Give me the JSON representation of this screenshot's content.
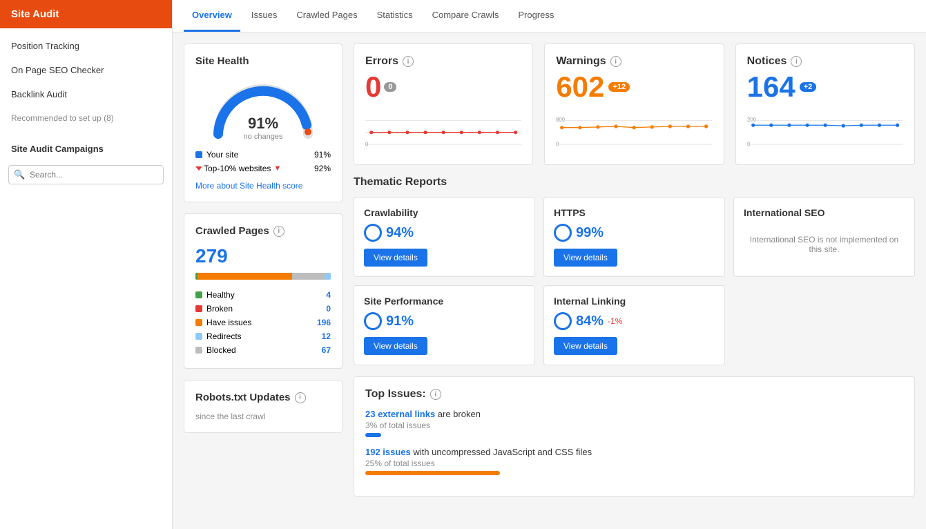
{
  "sidebar": {
    "header": "Site Audit",
    "nav": [
      {
        "label": "Position Tracking",
        "id": "position-tracking"
      },
      {
        "label": "On Page SEO Checker",
        "id": "on-page-seo"
      },
      {
        "label": "Backlink Audit",
        "id": "backlink-audit"
      },
      {
        "label": "Recommended to set up (8)",
        "id": "recommended",
        "muted": true
      }
    ],
    "campaigns_title": "Site Audit Campaigns",
    "search_placeholder": "Search..."
  },
  "tabs": [
    {
      "label": "Overview",
      "active": true
    },
    {
      "label": "Issues"
    },
    {
      "label": "Crawled Pages"
    },
    {
      "label": "Statistics"
    },
    {
      "label": "Compare Crawls"
    },
    {
      "label": "Progress"
    }
  ],
  "site_health": {
    "title": "Site Health",
    "percent": "91%",
    "subtext": "no changes",
    "legend": [
      {
        "label": "Your site",
        "value": "91%",
        "color": "#1a73e8"
      },
      {
        "label": "Top-10% websites",
        "value": "92%",
        "color": "#e53935",
        "has_arrow": true
      }
    ],
    "link": "More about Site Health score"
  },
  "crawled_pages": {
    "title": "Crawled Pages",
    "count": "279",
    "bar_segments": [
      {
        "color": "#43a047",
        "width": 1.4
      },
      {
        "color": "#f57c00",
        "width": 70
      },
      {
        "color": "#bdbdbd",
        "width": 24
      }
    ],
    "legend": [
      {
        "label": "Healthy",
        "count": "4",
        "color": "#43a047"
      },
      {
        "label": "Broken",
        "count": "0",
        "color": "#e53935"
      },
      {
        "label": "Have issues",
        "count": "196",
        "color": "#f57c00"
      },
      {
        "label": "Redirects",
        "count": "12",
        "color": "#90caf9"
      },
      {
        "label": "Blocked",
        "count": "67",
        "color": "#bdbdbd"
      }
    ]
  },
  "robots": {
    "title": "Robots.txt Updates",
    "subtext": "since the last crawl"
  },
  "metrics": {
    "errors": {
      "label": "Errors",
      "value": "0",
      "badge": "0",
      "badge_color": "gray"
    },
    "warnings": {
      "label": "Warnings",
      "value": "602",
      "badge": "+12",
      "badge_color": "orange"
    },
    "notices": {
      "label": "Notices",
      "value": "164",
      "badge": "+2",
      "badge_color": "blue"
    }
  },
  "thematic_reports": {
    "title": "Thematic Reports",
    "cards": [
      {
        "title": "Crawlability",
        "percent": "94%",
        "change": null,
        "has_button": true
      },
      {
        "title": "HTTPS",
        "percent": "99%",
        "change": null,
        "has_button": true
      },
      {
        "title": "International SEO",
        "percent": null,
        "change": null,
        "has_button": false,
        "no_impl": "International SEO is not implemented on this site."
      },
      {
        "title": "Site Performance",
        "percent": "91%",
        "change": null,
        "has_button": true
      },
      {
        "title": "Internal Linking",
        "percent": "84%",
        "change": "-1%",
        "has_button": true
      }
    ]
  },
  "top_issues": {
    "title": "Top Issues:",
    "issues": [
      {
        "link_text": "23 external links",
        "suffix": " are broken",
        "subtext": "3% of total issues",
        "bar_width": "3%",
        "bar_color": "blue"
      },
      {
        "link_text": "192 issues",
        "suffix": " with uncompressed JavaScript and CSS files",
        "subtext": "25% of total issues",
        "bar_width": "25%",
        "bar_color": "orange"
      }
    ]
  },
  "buttons": {
    "view_details": "View details"
  }
}
